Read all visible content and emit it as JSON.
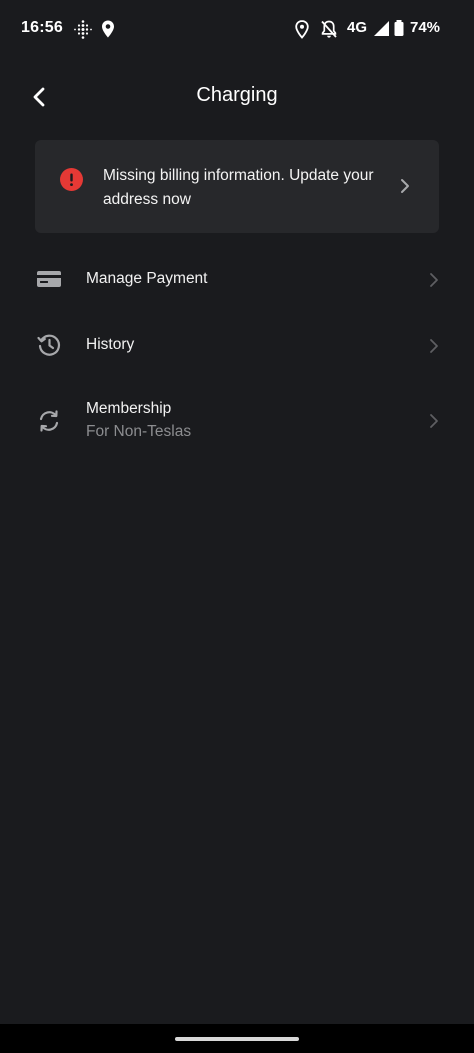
{
  "status_bar": {
    "time": "16:56",
    "network": "4G",
    "battery": "74%",
    "icons": [
      "fitbit-icon",
      "map-pin-icon",
      "location-icon",
      "bell-off-icon",
      "signal-icon",
      "battery-icon"
    ]
  },
  "header": {
    "title": "Charging",
    "back_icon": "chevron-left-icon"
  },
  "alert": {
    "text": "Missing billing information. Update your address now",
    "icon": "error-icon",
    "icon_color": "#e53935"
  },
  "menu": {
    "items": [
      {
        "label": "Manage Payment",
        "subtitle": "",
        "icon": "credit-card-icon"
      },
      {
        "label": "History",
        "subtitle": "",
        "icon": "history-icon"
      },
      {
        "label": "Membership",
        "subtitle": "For Non-Teslas",
        "icon": "refresh-icon"
      }
    ]
  },
  "colors": {
    "background": "#1a1b1e",
    "card": "#27282b",
    "text_primary": "#f2f2f2",
    "text_secondary": "#8c8d90",
    "alert_red": "#e53935"
  }
}
